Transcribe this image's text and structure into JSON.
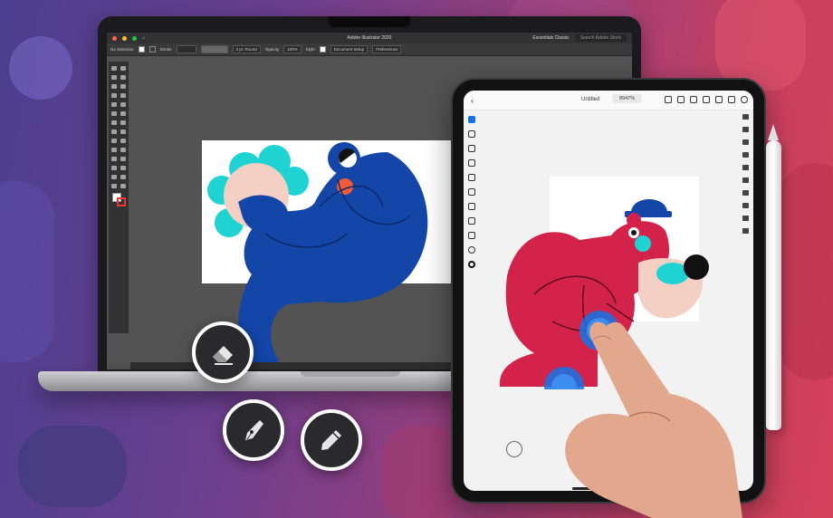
{
  "illustrator": {
    "app_title": "Adobe Illustrator 2020",
    "workspace": "Essentials Classic",
    "search_placeholder": "Search Adobe Stock",
    "control_bar": {
      "selection": "No Selection",
      "stroke_label": "Stroke",
      "brush": "3 pt. Round",
      "opacity_label": "Opacity",
      "opacity_value": "100%",
      "style_label": "Style",
      "document_setup": "Document Setup",
      "preferences": "Preferences"
    }
  },
  "ipad_app": {
    "doc_title": "Untitled",
    "zoom": "8947%"
  },
  "floating_tools": [
    {
      "name": "eraser",
      "icon": "eraser-icon"
    },
    {
      "name": "pen",
      "icon": "pen-tool-icon"
    },
    {
      "name": "pencil",
      "icon": "pencil-icon"
    }
  ],
  "colors": {
    "blue_character": "#1446a8",
    "red_character": "#d4234a",
    "skin": "#f3cfc4",
    "cyan": "#1fd3d3",
    "orange": "#f25a3a",
    "accent_blue": "#1473e6"
  }
}
